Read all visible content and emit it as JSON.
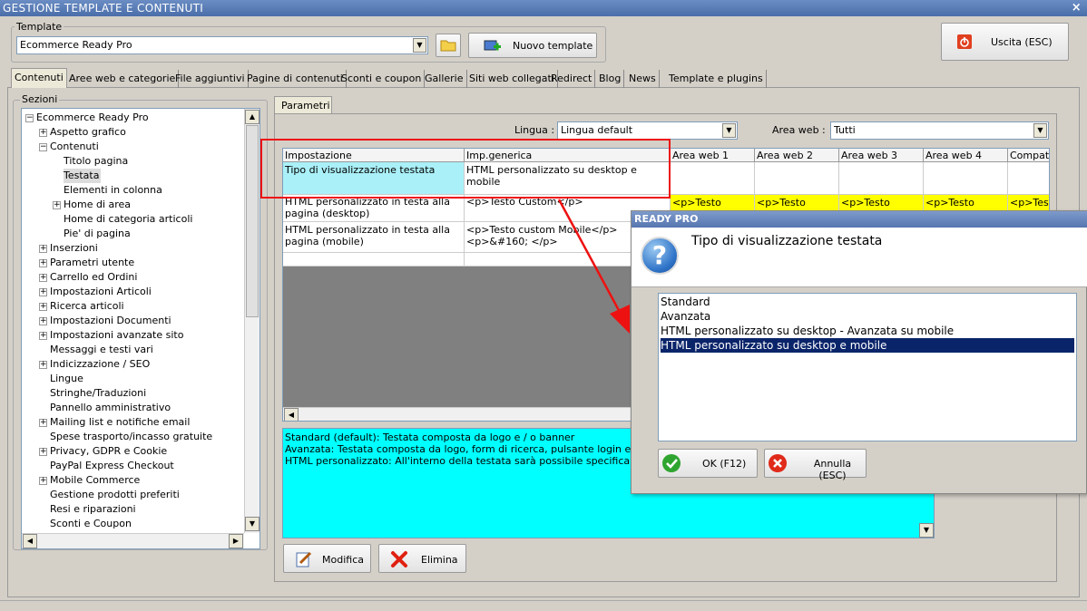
{
  "window": {
    "title": "GESTIONE TEMPLATE E CONTENUTI",
    "close": "×"
  },
  "template_group": {
    "label": "Template",
    "selected": "Ecommerce Ready Pro",
    "new_button": "Nuovo template"
  },
  "exit_button": "Uscita (ESC)",
  "tabs": [
    "Contenuti",
    "Aree web e categorie",
    "File aggiuntivi",
    "Pagine di contenuti",
    "Sconti e coupon",
    "Gallerie",
    "Siti web collegati",
    "Redirect",
    "Blog",
    "News",
    "Template e plugins"
  ],
  "sections": {
    "label": "Sezioni",
    "items": [
      {
        "label": "Ecommerce Ready Pro",
        "expander": "−"
      },
      {
        "label": "Aspetto grafico",
        "expander": "+"
      },
      {
        "label": "Contenuti",
        "expander": "−"
      },
      {
        "label": "Titolo pagina",
        "expander": ""
      },
      {
        "label": "Testata",
        "expander": ""
      },
      {
        "label": "Elementi in colonna",
        "expander": ""
      },
      {
        "label": "Home di area",
        "expander": "+"
      },
      {
        "label": "Home di categoria articoli",
        "expander": ""
      },
      {
        "label": "Pie' di pagina",
        "expander": ""
      },
      {
        "label": "Inserzioni",
        "expander": "+"
      },
      {
        "label": "Parametri utente",
        "expander": "+"
      },
      {
        "label": "Carrello ed Ordini",
        "expander": "+"
      },
      {
        "label": "Impostazioni Articoli",
        "expander": "+"
      },
      {
        "label": "Ricerca articoli",
        "expander": "+"
      },
      {
        "label": "Impostazioni Documenti",
        "expander": "+"
      },
      {
        "label": "Impostazioni avanzate sito",
        "expander": "+"
      },
      {
        "label": "Messaggi e testi vari",
        "expander": ""
      },
      {
        "label": "Indicizzazione / SEO",
        "expander": "+"
      },
      {
        "label": "Lingue",
        "expander": ""
      },
      {
        "label": "Stringhe/Traduzioni",
        "expander": ""
      },
      {
        "label": "Pannello amministrativo",
        "expander": ""
      },
      {
        "label": "Mailing list e notifiche email",
        "expander": "+"
      },
      {
        "label": "Spese trasporto/incasso gratuite",
        "expander": ""
      },
      {
        "label": "Privacy, GDPR e Cookie",
        "expander": "+"
      },
      {
        "label": "PayPal Express Checkout",
        "expander": ""
      },
      {
        "label": "Mobile Commerce",
        "expander": "+"
      },
      {
        "label": "Gestione prodotti preferiti",
        "expander": ""
      },
      {
        "label": "Resi e riparazioni",
        "expander": ""
      },
      {
        "label": "Sconti e Coupon",
        "expander": ""
      }
    ]
  },
  "params_tab": "Parametri",
  "lingua": {
    "label": "Lingua :",
    "value": "Lingua default"
  },
  "area_web": {
    "label": "Area web :",
    "value": "Tutti"
  },
  "grid": {
    "headers": [
      "Impostazione",
      "Imp.generica",
      "Area web 1",
      "Area web 2",
      "Area web 3",
      "Area web 4",
      "Compatib"
    ],
    "rows": [
      {
        "setting": "Tipo di visualizzazione testata",
        "generic": "HTML personalizzato su desktop e mobile",
        "areas": [
          "",
          "",
          "",
          "",
          ""
        ]
      },
      {
        "setting": "HTML personalizzato in testa alla pagina (desktop)",
        "generic": "<p>Testo Custom</p>",
        "areas": [
          "<p>Testo",
          "<p>Testo",
          "<p>Testo",
          "<p>Testo",
          "<p>Test"
        ]
      },
      {
        "setting": "HTML personalizzato in testa alla pagina (mobile)",
        "generic": "<p>Testo custom Mobile</p> <p>&#160; </p>",
        "areas": [
          "",
          "",
          "",
          "",
          ""
        ]
      }
    ]
  },
  "description": [
    "Standard (default): Testata composta da logo e / o banner",
    "Avanzata: Testata composta da logo, form di ricerca, pulsante login e carrello",
    "HTML personalizzato: All'interno della testata sarà possibile specificare del testo"
  ],
  "buttons": {
    "modify": "Modifica",
    "delete": "Elimina"
  },
  "dialog": {
    "title": "READY PRO",
    "question_icon": "?",
    "heading": "Tipo di visualizzazione testata",
    "options": [
      "Standard",
      "Avanzata",
      "HTML personalizzato su desktop - Avanzata su mobile",
      "HTML personalizzato su desktop e mobile"
    ],
    "selected_index": 3,
    "ok": "OK (F12)",
    "cancel": "Annulla (ESC)"
  },
  "colors": {
    "title_bar": "#5676b0",
    "highlight": "#ffff00",
    "selection": "#0a246a",
    "description_bg": "#00ffff",
    "annotation": "#ee1111"
  }
}
